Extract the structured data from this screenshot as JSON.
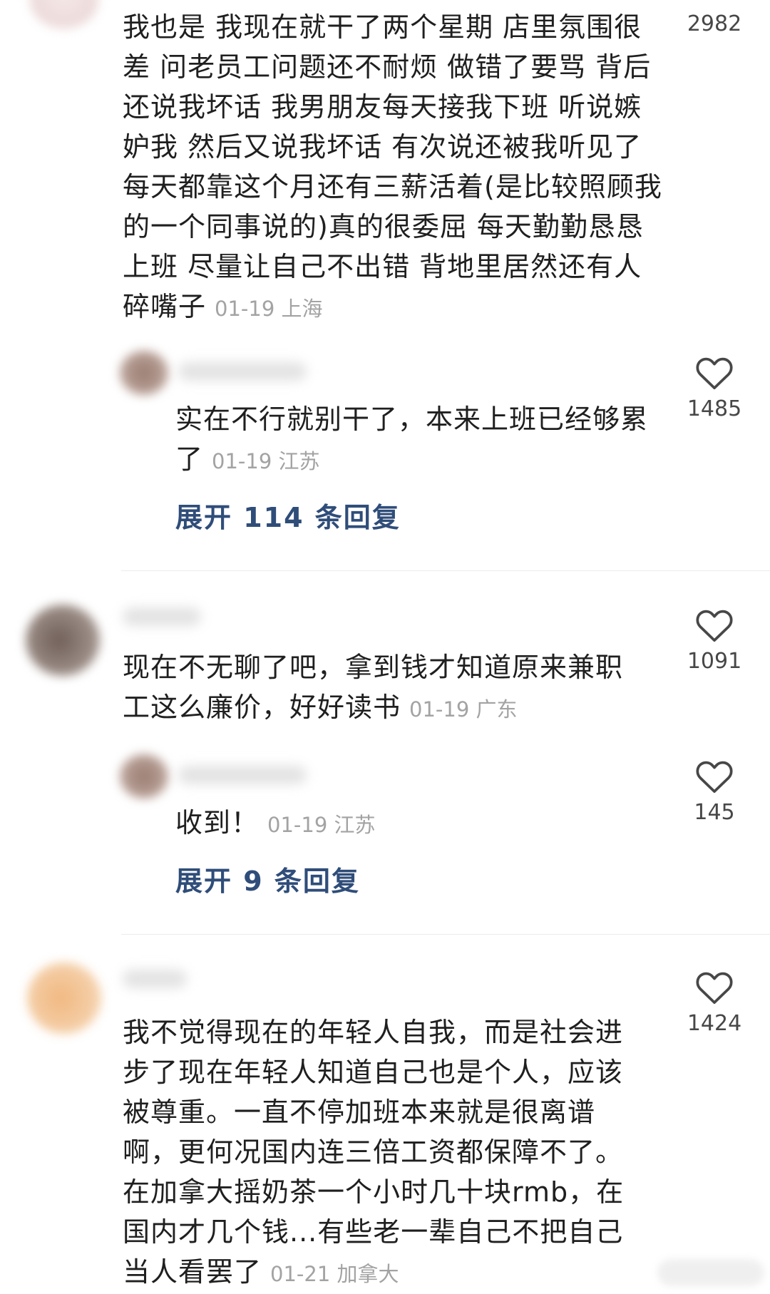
{
  "comments": [
    {
      "text": "我也是 我现在就干了两个星期 店里氛围很差 问老员工问题还不耐烦 做错了要骂 背后还说我坏话 我男朋友每天接我下班 听说嫉妒我 然后又说我坏话 有次说还被我听见了 每天都靠这个月还有三薪活着(是比较照顾我的一个同事说的)真的很委屈 每天勤勤恳恳上班 尽量让自己不出错 背地里居然还有人碎嘴子",
      "meta": "01-19 上海",
      "likes": "2982",
      "reply": {
        "text": "实在不行就别干了，本来上班已经够累了",
        "meta": "01-19 江苏",
        "likes": "1485"
      },
      "expand": "展开 114 条回复"
    },
    {
      "text": "现在不无聊了吧，拿到钱才知道原来兼职工这么廉价，好好读书",
      "meta": "01-19 广东",
      "likes": "1091",
      "reply": {
        "text": "收到！",
        "meta": "01-19 江苏",
        "likes": "145"
      },
      "expand": "展开 9 条回复"
    },
    {
      "text": "我不觉得现在的年轻人自我，而是社会进步了现在年轻人知道自己也是个人，应该被尊重。一直不停加班本来就是很离谱啊，更何况国内连三倍工资都保障不了。在加拿大摇奶茶一个小时几十块rmb，在国内才几个钱...有些老一辈自己不把自己当人看罢了",
      "meta": "01-21 加拿大",
      "likes": "1424"
    }
  ],
  "icons": {
    "like": "heart-outline-icon"
  },
  "colors": {
    "text": "#1f1f1f",
    "meta": "#a3a3a3",
    "link": "#2f4d79",
    "icon": "#474747"
  }
}
